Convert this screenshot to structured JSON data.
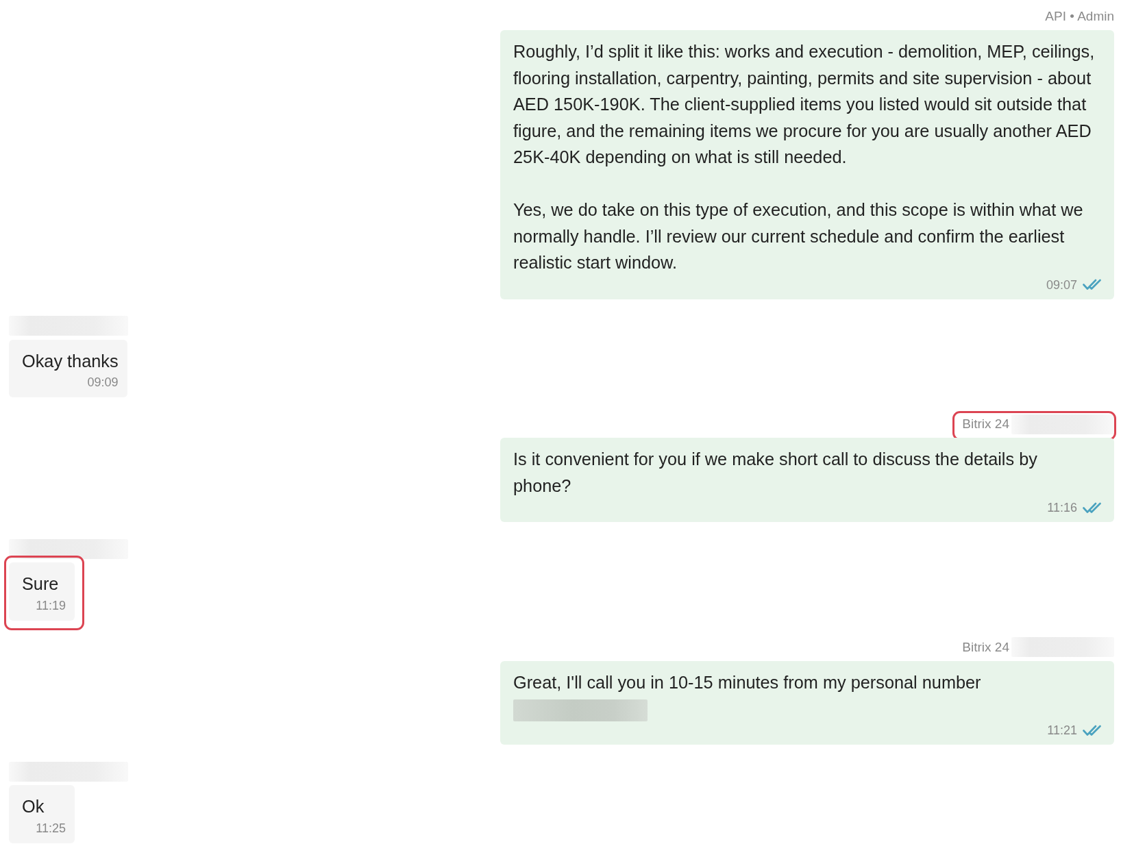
{
  "messages": [
    {
      "kind": "outgoing",
      "sender": "API • Admin",
      "sender_redacted": false,
      "header_highlighted": false,
      "bubble_highlighted": false,
      "paragraphs": [
        "Roughly, I’d split it like this: works and execution - demolition, MEP, ceilings, flooring installation, carpentry, painting, permits and site supervision - about AED 150K-190K. The client-supplied items you listed would sit outside that figure, and the remaining items we procure for you are usually another AED 25K-40K depending on what is still needed.",
        "Yes, we do take on this type of execution, and this scope is within what we normally handle. I’ll review our current schedule and confirm the earliest realistic start window."
      ],
      "time": "09:07",
      "read": true
    },
    {
      "kind": "incoming",
      "sender_redacted": true,
      "header_highlighted": false,
      "bubble_highlighted": false,
      "paragraphs": [
        "Okay thanks"
      ],
      "time": "09:09"
    },
    {
      "kind": "outgoing",
      "sender": "Bitrix 24",
      "sender_redacted": true,
      "header_highlighted": true,
      "bubble_highlighted": false,
      "paragraphs": [
        "Is it convenient for you if we make short call to discuss the details by phone?"
      ],
      "time": "11:16",
      "read": true
    },
    {
      "kind": "incoming",
      "sender_redacted": true,
      "header_highlighted": false,
      "bubble_highlighted": true,
      "paragraphs": [
        "Sure"
      ],
      "time": "11:19"
    },
    {
      "kind": "outgoing",
      "sender": "Bitrix 24",
      "sender_redacted": true,
      "header_highlighted": false,
      "bubble_highlighted": false,
      "paragraphs": [
        "Great, I'll call you in 10-15 minutes from my personal number"
      ],
      "redacted_line": true,
      "time": "11:21",
      "read": true
    },
    {
      "kind": "incoming",
      "sender_redacted": true,
      "header_highlighted": false,
      "bubble_highlighted": false,
      "paragraphs": [
        "Ok"
      ],
      "time": "11:25"
    }
  ]
}
